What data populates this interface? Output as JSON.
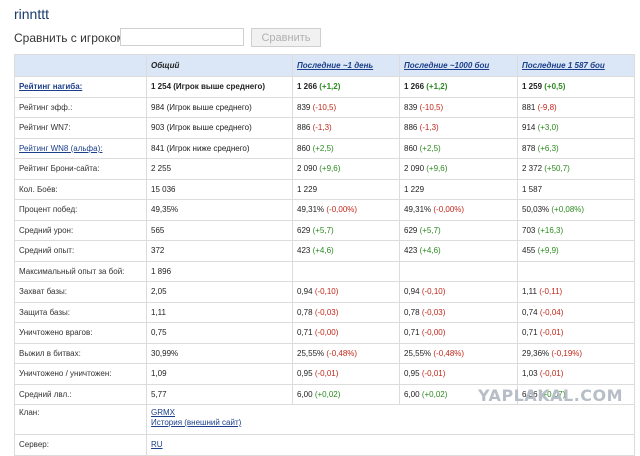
{
  "player": {
    "name": "rinnttt"
  },
  "compare": {
    "label": "Сравнить с игроком",
    "input_value": "",
    "button": "Сравнить"
  },
  "columns": [
    "",
    "Общий",
    "Последние ~1 день",
    "Последние ~1000 бои",
    "Последние 1 587 бои"
  ],
  "rows": [
    {
      "label": "Рейтинг нагиба:",
      "link": true,
      "bold": true,
      "cells": [
        {
          "value": "1 254 (Игрок выше среднего)"
        },
        {
          "value": "1 266",
          "delta": "(+1,2)",
          "dir": "pos"
        },
        {
          "value": "1 266",
          "delta": "(+1,2)",
          "dir": "pos"
        },
        {
          "value": "1 259",
          "delta": "(+0,5)",
          "dir": "pos"
        }
      ]
    },
    {
      "label": "Рейтинг эфф.:",
      "cells": [
        {
          "value": "984 (Игрок выше среднего)"
        },
        {
          "value": "839",
          "delta": "(-10,5)",
          "dir": "neg"
        },
        {
          "value": "839",
          "delta": "(-10,5)",
          "dir": "neg"
        },
        {
          "value": "881",
          "delta": "(-9,8)",
          "dir": "neg"
        }
      ]
    },
    {
      "label": "Рейтинг WN7:",
      "cells": [
        {
          "value": "903 (Игрок выше среднего)"
        },
        {
          "value": "886",
          "delta": "(-1,3)",
          "dir": "neg"
        },
        {
          "value": "886",
          "delta": "(-1,3)",
          "dir": "neg"
        },
        {
          "value": "914",
          "delta": "(+3,0)",
          "dir": "pos"
        }
      ]
    },
    {
      "label": "Рейтинг WN8 (альфа):",
      "link": true,
      "cells": [
        {
          "value": "841 (Игрок ниже среднего)"
        },
        {
          "value": "860",
          "delta": "(+2,5)",
          "dir": "pos"
        },
        {
          "value": "860",
          "delta": "(+2,5)",
          "dir": "pos"
        },
        {
          "value": "878",
          "delta": "(+6,3)",
          "dir": "pos"
        }
      ]
    },
    {
      "label": "Рейтинг Брони-сайта:",
      "cells": [
        {
          "value": "2 255"
        },
        {
          "value": "2 090",
          "delta": "(+9,6)",
          "dir": "pos"
        },
        {
          "value": "2 090",
          "delta": "(+9,6)",
          "dir": "pos"
        },
        {
          "value": "2 372",
          "delta": "(+50,7)",
          "dir": "pos"
        }
      ]
    },
    {
      "label": "Кол. Боёв:",
      "cells": [
        {
          "value": "15 036"
        },
        {
          "value": "1 229"
        },
        {
          "value": "1 229"
        },
        {
          "value": "1 587"
        }
      ]
    },
    {
      "label": "Процент побед:",
      "cells": [
        {
          "value": "49,35%"
        },
        {
          "value": "49,31%",
          "delta": "(-0,00%)",
          "dir": "neg"
        },
        {
          "value": "49,31%",
          "delta": "(-0,00%)",
          "dir": "neg"
        },
        {
          "value": "50,03%",
          "delta": "(+0,08%)",
          "dir": "pos"
        }
      ]
    },
    {
      "label": "Средний урон:",
      "cells": [
        {
          "value": "565"
        },
        {
          "value": "629",
          "delta": "(+5,7)",
          "dir": "pos"
        },
        {
          "value": "629",
          "delta": "(+5,7)",
          "dir": "pos"
        },
        {
          "value": "703",
          "delta": "(+16,3)",
          "dir": "pos"
        }
      ]
    },
    {
      "label": "Средний опыт:",
      "cells": [
        {
          "value": "372"
        },
        {
          "value": "423",
          "delta": "(+4,6)",
          "dir": "pos"
        },
        {
          "value": "423",
          "delta": "(+4,6)",
          "dir": "pos"
        },
        {
          "value": "455",
          "delta": "(+9,9)",
          "dir": "pos"
        }
      ]
    },
    {
      "label": "Максимальный опыт за бой:",
      "cells": [
        {
          "value": "1 896"
        },
        {
          "value": ""
        },
        {
          "value": ""
        },
        {
          "value": ""
        }
      ]
    },
    {
      "label": "Захват базы:",
      "cells": [
        {
          "value": "2,05"
        },
        {
          "value": "0,94",
          "delta": "(-0,10)",
          "dir": "neg"
        },
        {
          "value": "0,94",
          "delta": "(-0,10)",
          "dir": "neg"
        },
        {
          "value": "1,11",
          "delta": "(-0,11)",
          "dir": "neg"
        }
      ]
    },
    {
      "label": "Защита базы:",
      "cells": [
        {
          "value": "1,11"
        },
        {
          "value": "0,78",
          "delta": "(-0,03)",
          "dir": "neg"
        },
        {
          "value": "0,78",
          "delta": "(-0,03)",
          "dir": "neg"
        },
        {
          "value": "0,74",
          "delta": "(-0,04)",
          "dir": "neg"
        }
      ]
    },
    {
      "label": "Уничтожено врагов:",
      "cells": [
        {
          "value": "0,75"
        },
        {
          "value": "0,71",
          "delta": "(-0,00)",
          "dir": "neg"
        },
        {
          "value": "0,71",
          "delta": "(-0,00)",
          "dir": "neg"
        },
        {
          "value": "0,71",
          "delta": "(-0,01)",
          "dir": "neg"
        }
      ]
    },
    {
      "label": "Выжил в битвах:",
      "cells": [
        {
          "value": "30,99%"
        },
        {
          "value": "25,55%",
          "delta": "(-0,48%)",
          "dir": "neg"
        },
        {
          "value": "25,55%",
          "delta": "(-0,48%)",
          "dir": "neg"
        },
        {
          "value": "29,36%",
          "delta": "(-0,19%)",
          "dir": "neg"
        }
      ]
    },
    {
      "label": "Уничтожено / уничтожен:",
      "cells": [
        {
          "value": "1,09"
        },
        {
          "value": "0,95",
          "delta": "(-0,01)",
          "dir": "neg"
        },
        {
          "value": "0,95",
          "delta": "(-0,01)",
          "dir": "neg"
        },
        {
          "value": "1,03",
          "delta": "(-0,01)",
          "dir": "neg"
        }
      ]
    },
    {
      "label": "Средний лвл.:",
      "cells": [
        {
          "value": "5,77"
        },
        {
          "value": "6,00",
          "delta": "(+0,02)",
          "dir": "pos"
        },
        {
          "value": "6,00",
          "delta": "(+0,02)",
          "dir": "pos"
        },
        {
          "value": "6,36",
          "delta": "(+0,07)",
          "dir": "pos"
        }
      ]
    }
  ],
  "clan": {
    "label": "Клан:",
    "tag": "GRMX",
    "history": "История (внешний сайт)"
  },
  "server": {
    "label": "Сервер:",
    "value": "RU"
  },
  "watermark": "YAPLAKAL.COM"
}
